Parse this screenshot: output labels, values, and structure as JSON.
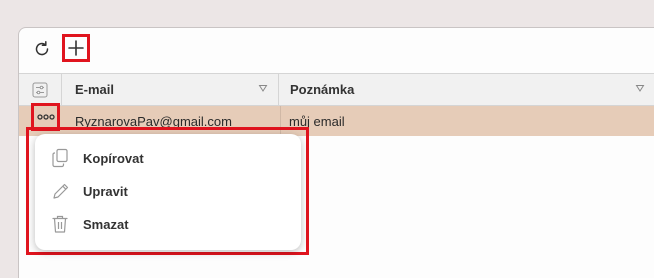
{
  "toolbar": {
    "refresh_icon": "refresh-icon",
    "add_icon": "plus-icon"
  },
  "table": {
    "columns": [
      {
        "label": "E-mail"
      },
      {
        "label": "Poznámka"
      }
    ],
    "rows": [
      {
        "email": "RyznarovaPav@gmail.com",
        "note": "můj email"
      }
    ]
  },
  "context_menu": {
    "items": [
      {
        "label": "Kopírovat",
        "icon": "copy-icon"
      },
      {
        "label": "Upravit",
        "icon": "pencil-icon"
      },
      {
        "label": "Smazat",
        "icon": "trash-icon"
      }
    ]
  },
  "colors": {
    "selected_row": "#e6ccb8",
    "highlight_outline": "#e0141e"
  }
}
